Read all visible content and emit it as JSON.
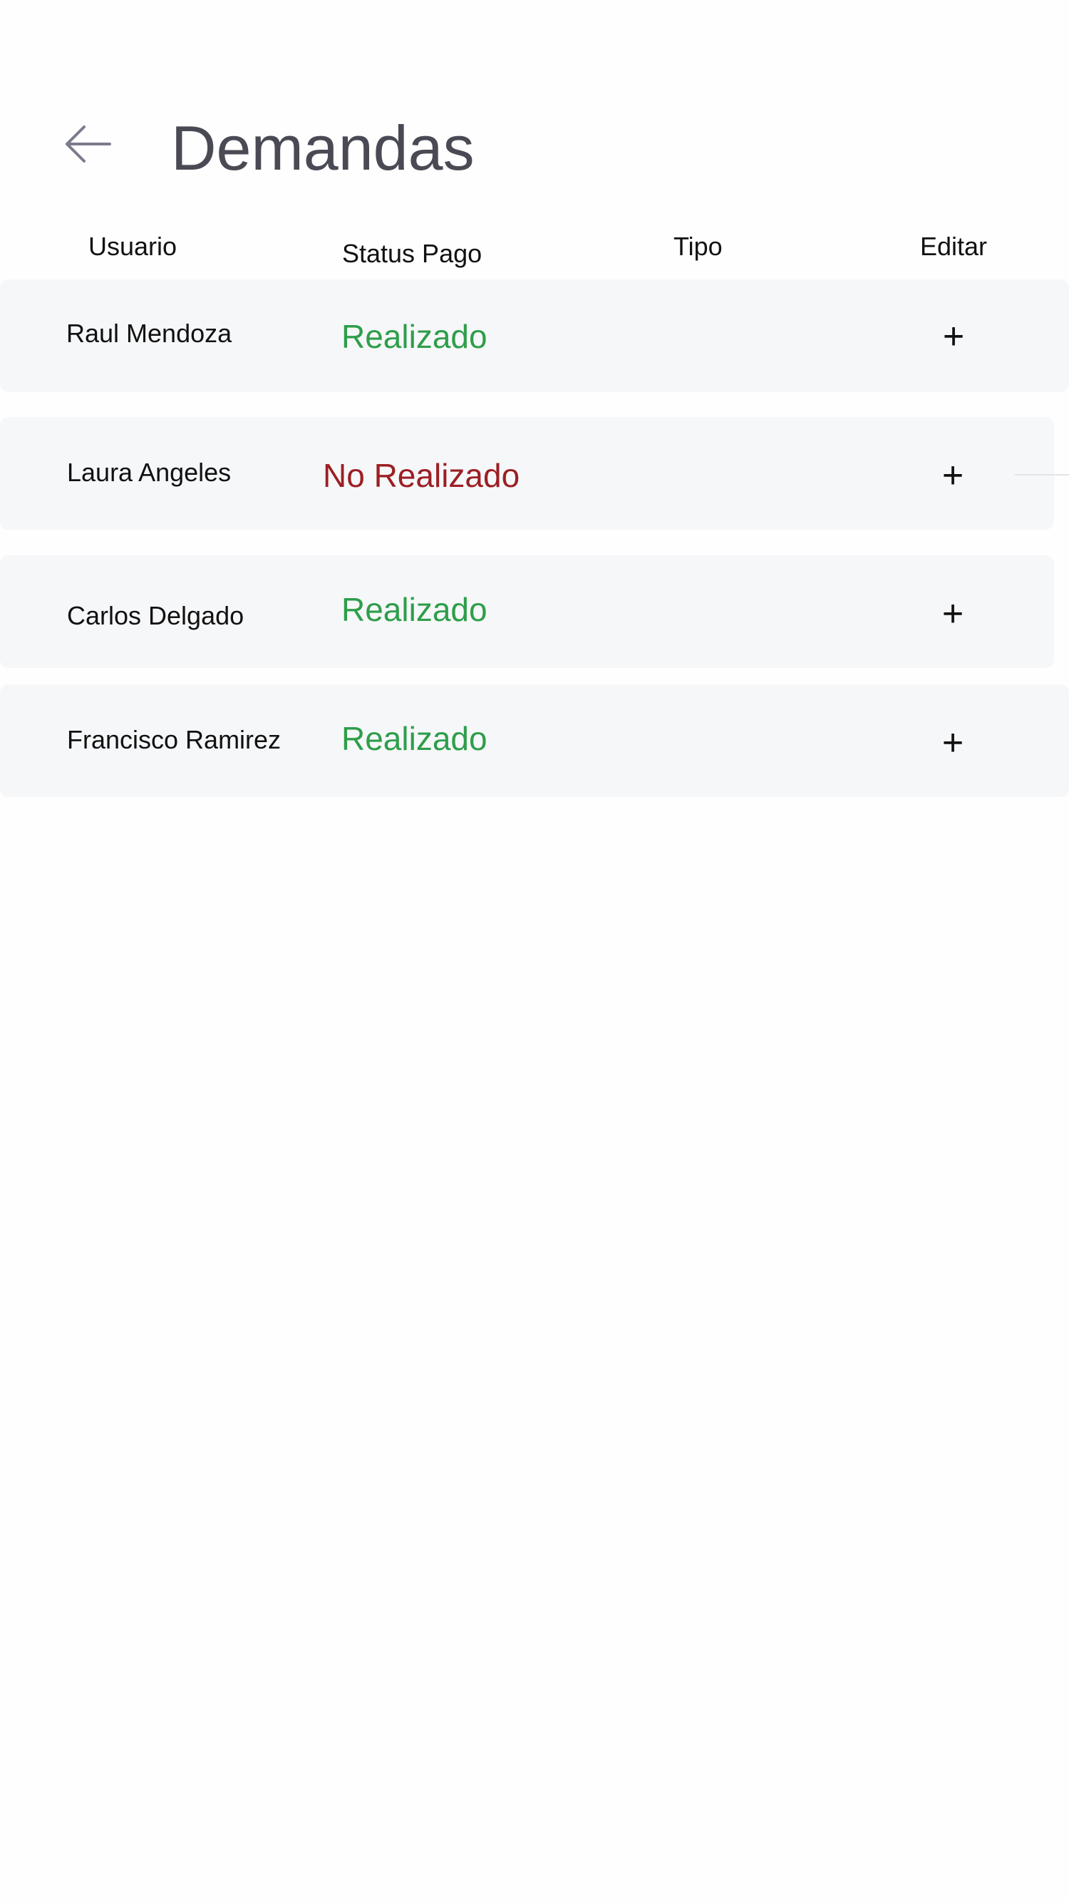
{
  "header": {
    "title": "Demandas",
    "back_icon": "arrow-left-icon"
  },
  "table": {
    "columns": [
      "Usuario",
      "Status Pago",
      "Tipo",
      "Editar"
    ],
    "rows": [
      {
        "usuario": "Raul Mendoza",
        "status": "Realizado",
        "status_type": "ok",
        "tipo": "",
        "edit_label": "+"
      },
      {
        "usuario": "Laura Angeles",
        "status": "No Realizado",
        "status_type": "bad",
        "tipo": "",
        "edit_label": "+"
      },
      {
        "usuario": "Carlos Delgado",
        "status": "Realizado",
        "status_type": "ok",
        "tipo": "",
        "edit_label": "+"
      },
      {
        "usuario": "Francisco Ramirez",
        "status": "Realizado",
        "status_type": "ok",
        "tipo": "",
        "edit_label": "+"
      }
    ]
  },
  "colors": {
    "status_ok": "#2e9e4a",
    "status_bad": "#9c1f24",
    "row_bg": "#f6f7f9",
    "title": "#4a4a55"
  }
}
